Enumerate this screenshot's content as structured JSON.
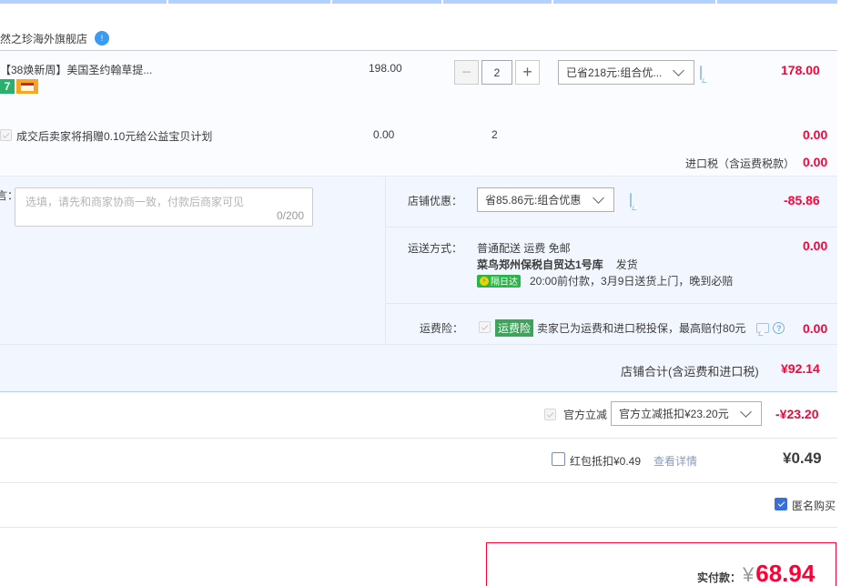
{
  "shop": {
    "name": "然之珍海外旗舰店",
    "badge": "!"
  },
  "item": {
    "title": "【38焕新周】美国圣约翰草提...",
    "tag_number": "7",
    "price": "198.00",
    "quantity": "2",
    "discount_select": "已省218元:组合优...",
    "subtotal": "178.00"
  },
  "charity": {
    "label": "成交后卖家将捐赠0.10元给公益宝贝计划",
    "price": "0.00",
    "quantity": "2",
    "subtotal": "0.00"
  },
  "tax": {
    "label": "进口税（含运费税款）",
    "value": "0.00"
  },
  "message": {
    "label": "言：",
    "placeholder": "选填，请先和商家协商一致，付款后商家可见",
    "counter": "0/200"
  },
  "shop_discount": {
    "label": "店铺优惠：",
    "select": "省85.86元:组合优惠",
    "value": "-85.86"
  },
  "shipping": {
    "label": "运送方式：",
    "method": "普通配送 运费 免邮",
    "warehouse": "菜鸟郑州保税自贸达1号库",
    "ship_text": "发货",
    "fast_tag": "隔日达",
    "promise": "20:00前付款，3月9日送货上门，晚到必赔",
    "value": "0.00"
  },
  "insurance": {
    "label": "运费险：",
    "tag": "运费险",
    "text": "卖家已为运费和进口税投保，最高赔付80元",
    "value": "0.00"
  },
  "shop_total": {
    "label": "店铺合计(含运费和进口税)",
    "value": "¥92.14"
  },
  "official": {
    "check_label": "官方立减",
    "select": "官方立减抵扣¥23.20元",
    "value": "-¥23.20"
  },
  "redpacket": {
    "label": "红包抵扣¥0.49",
    "link": "查看详情",
    "value": "¥0.49"
  },
  "anonymous": {
    "label": "匿名购买"
  },
  "pay": {
    "label": "实付款：",
    "currency": "¥",
    "amount": "68.94"
  },
  "colors": {
    "accent": "#ff0036",
    "blue_line": "#b2d1ff",
    "section_bg": "#f2f7ff"
  }
}
